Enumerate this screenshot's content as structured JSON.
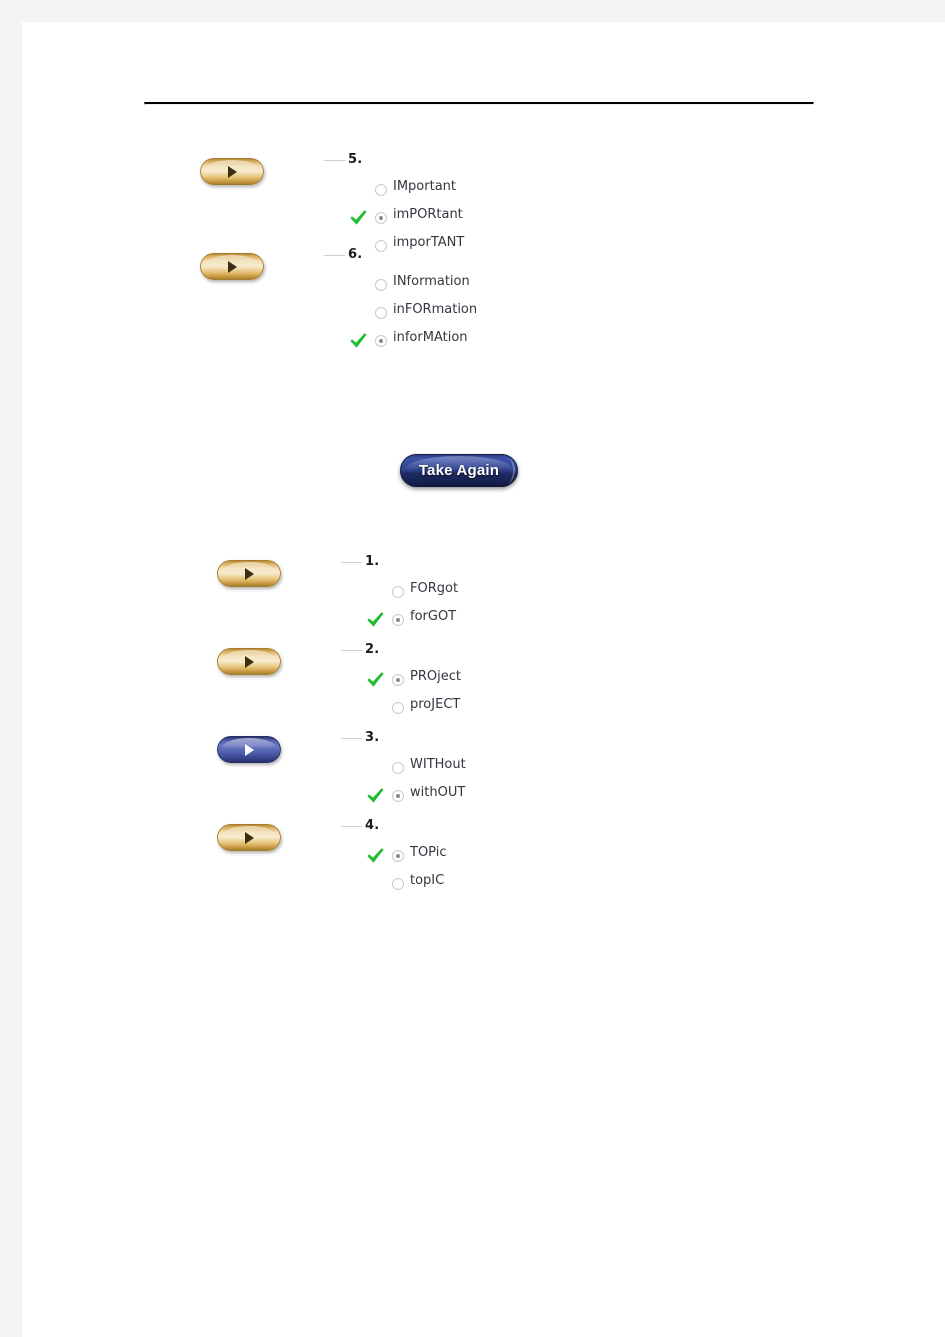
{
  "page": {
    "background_color": "#f4f4f4",
    "paper_color": "#ffffff",
    "divider_color": "#000000",
    "check_color": "#22bb33",
    "gold_button_color": "#d9ae5e",
    "blue_button_color": "#4a5aa8",
    "take_again_color": "#2a3a7e"
  },
  "sections": [
    {
      "name": "quiz-results-part-1",
      "questions": [
        {
          "number": "5.",
          "button_icon": "play-arrow-icon",
          "button_style": "gold",
          "options": [
            {
              "label": "IMportant",
              "selected": false,
              "correct": false
            },
            {
              "label": "imPORtant",
              "selected": true,
              "correct": true
            },
            {
              "label": "imporTANT",
              "selected": false,
              "correct": false
            }
          ]
        },
        {
          "number": "6.",
          "button_icon": "play-arrow-icon",
          "button_style": "gold",
          "options": [
            {
              "label": "INformation",
              "selected": false,
              "correct": false
            },
            {
              "label": "inFORmation",
              "selected": false,
              "correct": false
            },
            {
              "label": "inforMAtion",
              "selected": true,
              "correct": true
            }
          ]
        }
      ]
    },
    {
      "name": "quiz-results-part-2",
      "questions": [
        {
          "number": "1.",
          "button_icon": "play-arrow-icon",
          "button_style": "gold",
          "options": [
            {
              "label": "FORgot",
              "selected": false,
              "correct": false
            },
            {
              "label": "forGOT",
              "selected": true,
              "correct": true
            }
          ]
        },
        {
          "number": "2.",
          "button_icon": "play-arrow-icon",
          "button_style": "gold",
          "options": [
            {
              "label": "PROject",
              "selected": true,
              "correct": true
            },
            {
              "label": "proJECT",
              "selected": false,
              "correct": false
            }
          ]
        },
        {
          "number": "3.",
          "button_icon": "play-arrow-icon",
          "button_style": "blue",
          "options": [
            {
              "label": "WITHout",
              "selected": false,
              "correct": false
            },
            {
              "label": "withOUT",
              "selected": true,
              "correct": true
            }
          ]
        },
        {
          "number": "4.",
          "button_icon": "play-arrow-icon",
          "button_style": "gold",
          "options": [
            {
              "label": "TOPic",
              "selected": true,
              "correct": true
            },
            {
              "label": "topIC",
              "selected": false,
              "correct": false
            }
          ]
        }
      ]
    }
  ],
  "take_again": {
    "label": "Take Again"
  }
}
